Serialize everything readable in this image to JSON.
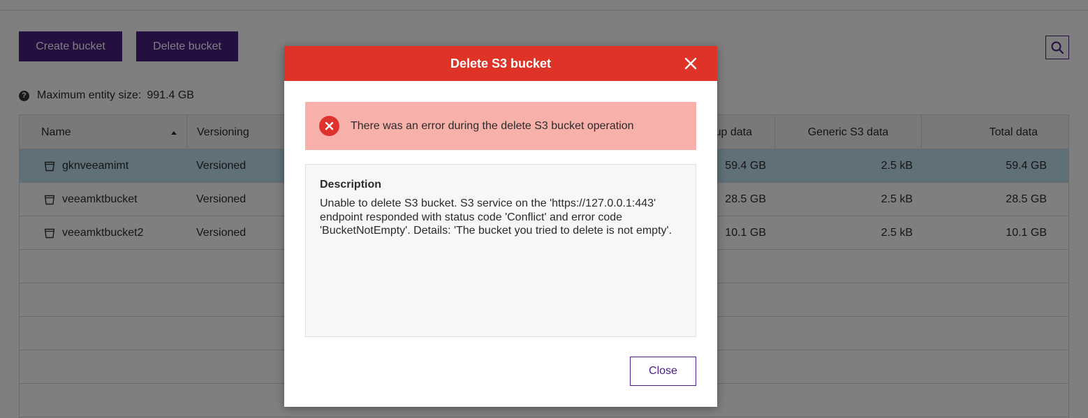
{
  "toolbar": {
    "create_label": "Create bucket",
    "delete_label": "Delete bucket"
  },
  "max_entity": {
    "help_glyph": "?",
    "label": "Maximum entity size:",
    "value": "991.4 GB"
  },
  "table": {
    "columns": {
      "name": "Name",
      "versioning": "Versioning",
      "backup": "Backup data",
      "generic": "Generic S3 data",
      "total": "Total data"
    },
    "rows": [
      {
        "name": "gknveeamimt",
        "versioning": "Versioned",
        "backup": "59.4 GB",
        "generic": "2.5 kB",
        "total": "59.4 GB",
        "selected": true
      },
      {
        "name": "veeamktbucket",
        "versioning": "Versioned",
        "backup": "28.5 GB",
        "generic": "2.5 kB",
        "total": "28.5 GB",
        "selected": false
      },
      {
        "name": "veeamktbucket2",
        "versioning": "Versioned",
        "backup": "10.1 GB",
        "generic": "2.5 kB",
        "total": "10.1 GB",
        "selected": false
      }
    ]
  },
  "dialog": {
    "title": "Delete S3 bucket",
    "error_message": "There was an error during the delete S3 bucket operation",
    "description_title": "Description",
    "description_text": "Unable to delete S3 bucket. S3 service on the 'https://127.0.0.1:443' endpoint responded with status code 'Conflict' and error code 'BucketNotEmpty'. Details: 'The bucket you tried to delete is not empty'.",
    "close_label": "Close"
  },
  "colors": {
    "accent": "#4b1d80",
    "dialog_header": "#df3328",
    "error_banner": "#f8b0aa",
    "selected_row": "#bfe0f3"
  },
  "icons": {
    "search": "search-icon",
    "help": "help-icon",
    "sort": "sort-ascending-icon",
    "bucket": "bucket-icon",
    "close": "close-icon",
    "error": "error-icon"
  }
}
